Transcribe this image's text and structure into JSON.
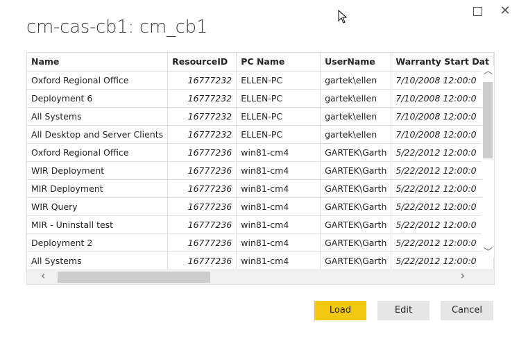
{
  "dialog": {
    "title": "cm-cas-cb1: cm_cb1"
  },
  "table": {
    "columns": [
      "Name",
      "ResourceID",
      "PC Name",
      "UserName",
      "Warranty Start Dat"
    ],
    "rows": [
      [
        "Oxford Regional Office",
        "16777232",
        "ELLEN-PC",
        "gartek\\ellen",
        "7/10/2008 12:00:0"
      ],
      [
        "Deployment 6",
        "16777232",
        "ELLEN-PC",
        "gartek\\ellen",
        "7/10/2008 12:00:0"
      ],
      [
        "All Systems",
        "16777232",
        "ELLEN-PC",
        "gartek\\ellen",
        "7/10/2008 12:00:0"
      ],
      [
        "All Desktop and Server Clients",
        "16777232",
        "ELLEN-PC",
        "gartek\\ellen",
        "7/10/2008 12:00:0"
      ],
      [
        "Oxford Regional Office",
        "16777236",
        "win81-cm4",
        "GARTEK\\Garth",
        "5/22/2012 12:00:0"
      ],
      [
        "WIR Deployment",
        "16777236",
        "win81-cm4",
        "GARTEK\\Garth",
        "5/22/2012 12:00:0"
      ],
      [
        "MIR Deployment",
        "16777236",
        "win81-cm4",
        "GARTEK\\Garth",
        "5/22/2012 12:00:0"
      ],
      [
        "WIR Query",
        "16777236",
        "win81-cm4",
        "GARTEK\\Garth",
        "5/22/2012 12:00:0"
      ],
      [
        "MIR - Uninstall test",
        "16777236",
        "win81-cm4",
        "GARTEK\\Garth",
        "5/22/2012 12:00:0"
      ],
      [
        "Deployment 2",
        "16777236",
        "win81-cm4",
        "GARTEK\\Garth",
        "5/22/2012 12:00:0"
      ],
      [
        "All Systems",
        "16777236",
        "win81-cm4",
        "GARTEK\\Garth",
        "5/22/2012 12:00:0"
      ]
    ]
  },
  "buttons": {
    "load": "Load",
    "edit": "Edit",
    "cancel": "Cancel"
  },
  "icons": {
    "maximize": "maximize-icon",
    "close": "close-icon",
    "up": "chevron-up-icon",
    "down": "chevron-down-icon",
    "left": "chevron-left-icon",
    "right": "chevron-right-icon"
  },
  "colors": {
    "accent": "#f2c811",
    "secondary_button": "#e6e6e6"
  }
}
